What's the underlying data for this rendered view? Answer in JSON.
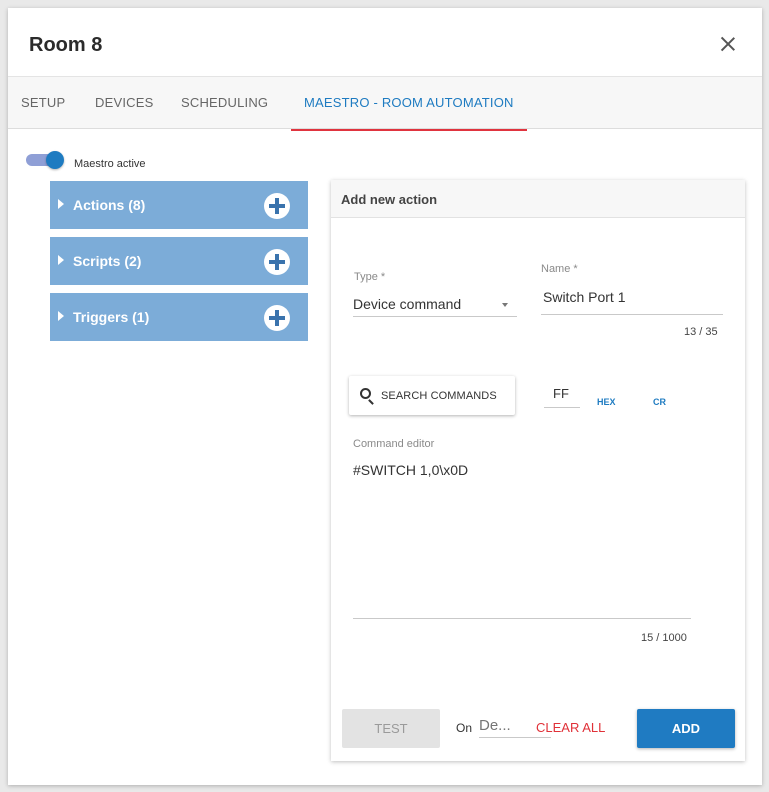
{
  "dialog": {
    "title": "Room 8"
  },
  "tabs": [
    {
      "label": "SETUP"
    },
    {
      "label": "DEVICES"
    },
    {
      "label": "SCHEDULING"
    },
    {
      "label": "MAESTRO - ROOM AUTOMATION"
    }
  ],
  "maestro": {
    "toggle_label": "Maestro active",
    "active": true
  },
  "accordion": [
    {
      "label": "Actions (8)"
    },
    {
      "label": "Scripts (2)"
    },
    {
      "label": "Triggers (1)"
    }
  ],
  "form": {
    "title": "Add new action",
    "type_label": "Type *",
    "type_value": "Device command",
    "name_label": "Name *",
    "name_value": "Switch Port 1",
    "name_counter": "13 / 35",
    "search_label": "SEARCH COMMANDS",
    "ff_value": "FF",
    "hex_label": "HEX",
    "cr_label": "CR",
    "command_label": "Command editor",
    "command_value": "#SWITCH 1,0\\x0D",
    "command_counter": "15 / 1000",
    "test_label": "TEST",
    "on_label": "On",
    "device_placeholder": "De...",
    "clear_label": "CLEAR ALL",
    "add_label": "ADD"
  },
  "colors": {
    "accent": "#1e7bc1",
    "tab_underline": "#e0343f",
    "accordion_bg": "#7cacd8",
    "clear": "#e03138"
  }
}
